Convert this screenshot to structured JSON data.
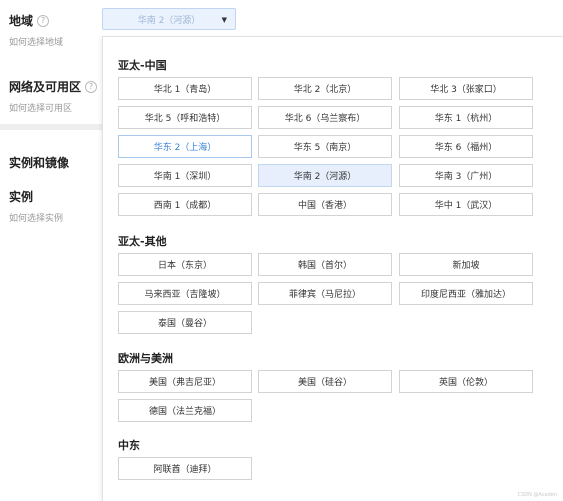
{
  "left_panel": {
    "region": {
      "label": "地域",
      "help": "?",
      "sub": "如何选择地域"
    },
    "network": {
      "label": "网络及可用区",
      "help": "?",
      "sub": "如何选择可用区"
    },
    "instance_image": {
      "label": "实例和镜像"
    },
    "instance": {
      "label": "实例",
      "sub": "如何选择实例"
    }
  },
  "select": {
    "value": "华南 2（河源）",
    "arrow": "▼"
  },
  "groups": [
    {
      "title": "亚太-中国",
      "items": [
        "华北 1（青岛）",
        "华北 2（北京）",
        "华北 3（张家口）",
        "华北 5（呼和浩特）",
        "华北 6（乌兰察布）",
        "华东 1（杭州）",
        "华东 2（上海）",
        "华东 5（南京）",
        "华东 6（福州）",
        "华南 1（深圳）",
        "华南 2（河源）",
        "华南 3（广州）",
        "西南 1（成都）",
        "中国（香港）",
        "华中 1（武汉）"
      ]
    },
    {
      "title": "亚太-其他",
      "items": [
        "日本（东京）",
        "韩国（首尔）",
        "新加坡",
        "马来西亚（吉隆坡）",
        "菲律宾（马尼拉）",
        "印度尼西亚（雅加达）",
        "泰国（曼谷）"
      ]
    },
    {
      "title": "欧洲与美洲",
      "items": [
        "美国（弗吉尼亚）",
        "美国（硅谷）",
        "英国（伦敦）",
        "德国（法兰克福）"
      ]
    },
    {
      "title": "中东",
      "items": [
        "阿联酋（迪拜）"
      ]
    }
  ],
  "active_item": "华东 2（上海）",
  "selected_item": "华南 2（河源）",
  "colors": {
    "accent": "#3c83d8",
    "selected_bg": "#e6effb"
  },
  "watermark": "CSDN @Acaden"
}
